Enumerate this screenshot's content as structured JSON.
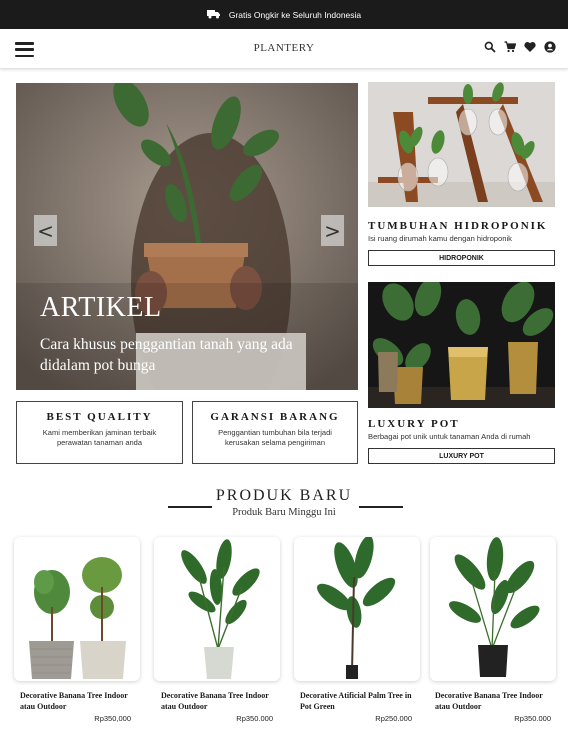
{
  "announcement": {
    "text": "Gratis Ongkir ke Seluruh Indonesia",
    "icon": "truck-icon"
  },
  "navbar": {
    "brand": "PLANTERY",
    "icons": [
      "menu-icon",
      "search-icon",
      "cart-icon",
      "heart-icon",
      "account-icon"
    ]
  },
  "hero": {
    "title": "ARTIKEL",
    "subtitle": "Cara khusus penggantian tanah yang ada didalam pot bunga",
    "prev_label": "<",
    "next_label": ">"
  },
  "features": [
    {
      "title": "BEST QUALITY",
      "desc": "Kami memberikan jaminan terbaik perawatan tanaman anda"
    },
    {
      "title": "GARANSI BARANG",
      "desc": "Penggantian tumbuhan bila terjadi kerusakan selama pengiriman"
    }
  ],
  "side": [
    {
      "title": "TUMBUHAN HIDROPONIK",
      "desc": "Isi ruang dirumah kamu dengan hidroponik",
      "button": "HIDROPONIK"
    },
    {
      "title": "LUXURY POT",
      "desc": "Berbagai pot unik untuk tanaman Anda di rumah",
      "button": "LUXURY POT"
    }
  ],
  "products_section": {
    "title": "PRODUK BARU",
    "subtitle": "Produk Baru Minggu Ini"
  },
  "products": [
    {
      "name": "Decorative Banana Tree Indoor atau Outdoor",
      "price": "Rp350,000"
    },
    {
      "name": "Decorative Banana Tree Indoor atau Outdoor",
      "price": "Rp350.000"
    },
    {
      "name": "Decorative Atificial Palm Tree in Pot Green",
      "price": "Rp250.000"
    },
    {
      "name": "Decorative Banana Tree Indoor atau Outdoor",
      "price": "Rp350.000"
    }
  ],
  "colors": {
    "topbar": "#1b1b1b",
    "text": "#1a1a1a",
    "plant_green": "#3f7a35",
    "gold_pot": "#c9a54a"
  }
}
